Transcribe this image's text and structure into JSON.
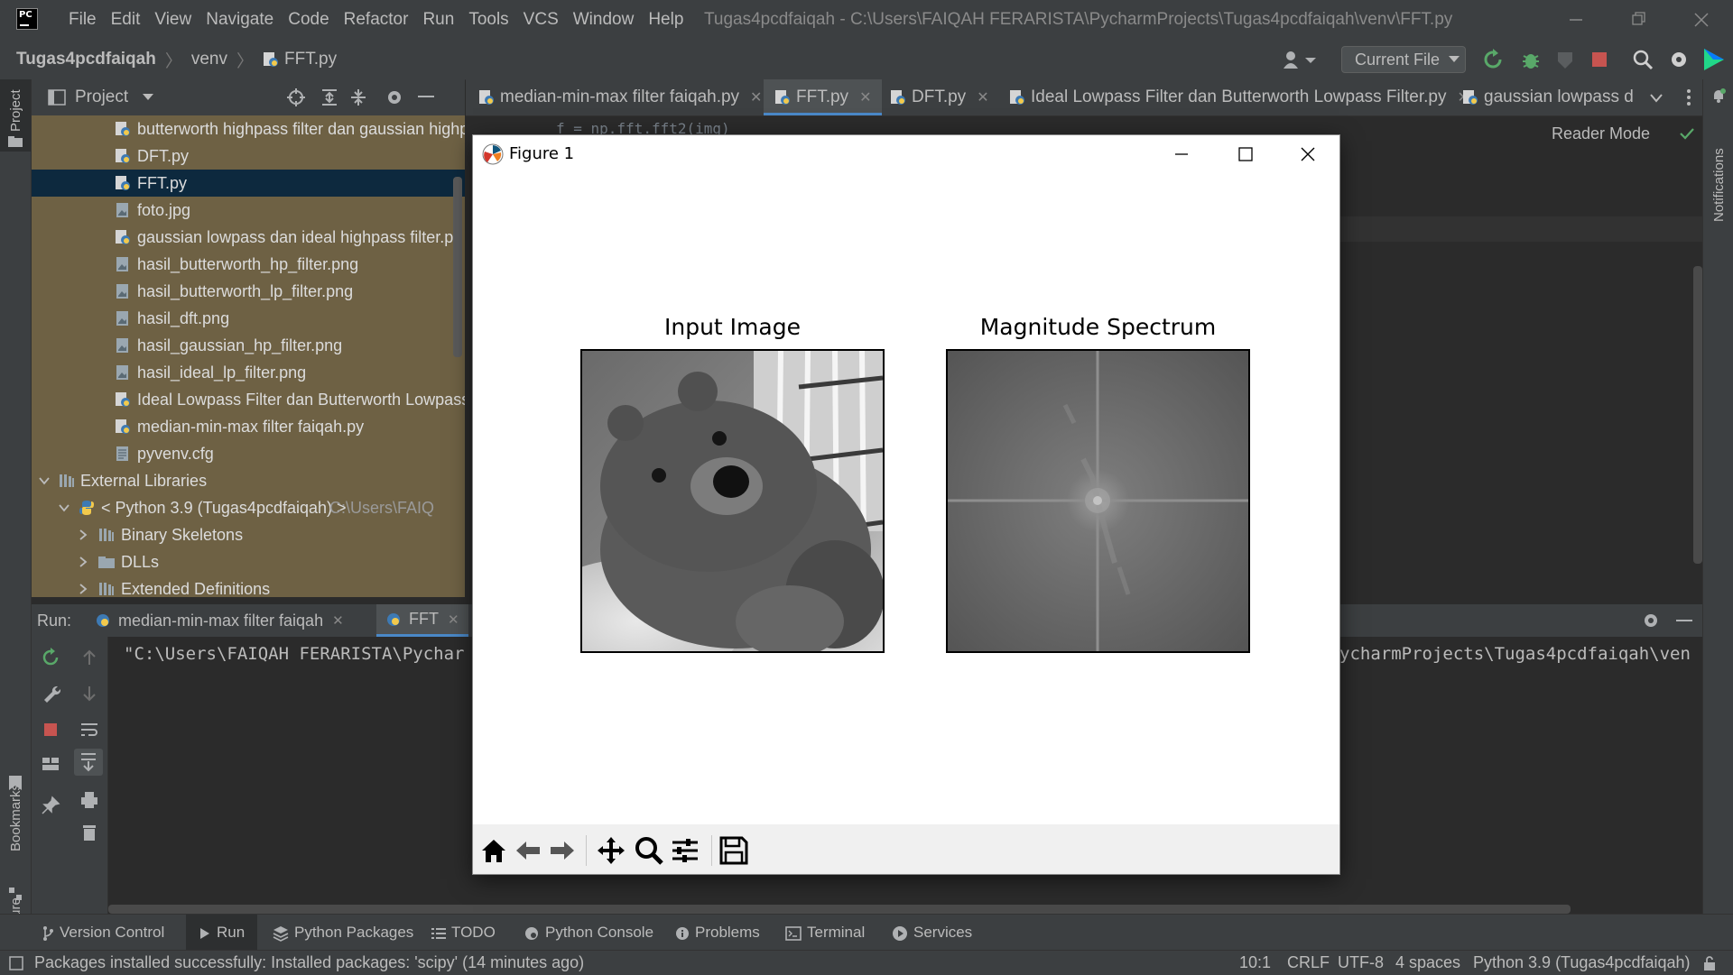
{
  "menubar": {
    "items": [
      "File",
      "Edit",
      "View",
      "Navigate",
      "Code",
      "Refactor",
      "Run",
      "Tools",
      "VCS",
      "Window",
      "Help"
    ],
    "window_title": "Tugas4pcdfaiqah - C:\\Users\\FAIQAH FERARISTA\\PycharmProjects\\Tugas4pcdfaiqah\\venv\\FFT.py"
  },
  "navbar": {
    "crumbs": [
      "Tugas4pcdfaiqah",
      "venv",
      "FFT.py"
    ],
    "run_config": "Current File"
  },
  "left_stripe": {
    "project": "Project",
    "bookmarks": "Bookmarks",
    "structure": "Structure"
  },
  "right_stripe": {
    "notifications": "Notifications"
  },
  "project_panel": {
    "title": "Project",
    "files": [
      "butterworth highpass filter dan gaussian highp",
      "DFT.py",
      "FFT.py",
      "foto.jpg",
      "gaussian lowpass dan ideal highpass filter.py",
      "hasil_butterworth_hp_filter.png",
      "hasil_butterworth_lp_filter.png",
      "hasil_dft.png",
      "hasil_gaussian_hp_filter.png",
      "hasil_ideal_lp_filter.png",
      "Ideal Lowpass Filter dan Butterworth Lowpass",
      "median-min-max filter faiqah.py",
      "pyvenv.cfg"
    ],
    "external_libraries": "External Libraries",
    "python_sdk": "< Python 3.9 (Tugas4pcdfaiqah) >",
    "python_sdk_path": "C:\\Users\\FAIQ",
    "binary_skeletons": "Binary Skeletons",
    "dlls": "DLLs",
    "extended_definitions": "Extended Definitions"
  },
  "editor_tabs": [
    {
      "label": "median-min-max filter faiqah.py",
      "active": false
    },
    {
      "label": "FFT.py",
      "active": true
    },
    {
      "label": "DFT.py",
      "active": false
    },
    {
      "label": "Ideal Lowpass Filter dan Butterworth Lowpass Filter.py",
      "active": false
    },
    {
      "label": "gaussian lowpass d",
      "active": false
    }
  ],
  "editor": {
    "reader_mode": "Reader Mode",
    "code_fragment": "f = np.fft.fft2(img)"
  },
  "run_panel": {
    "label": "Run:",
    "tabs": [
      "median-min-max filter faiqah",
      "FFT"
    ],
    "console_left": "\"C:\\Users\\FAIQAH FERARISTA\\Pychar",
    "console_right": "ycharmProjects\\Tugas4pcdfaiqah\\ven"
  },
  "tool_windows": [
    "Version Control",
    "Run",
    "Python Packages",
    "TODO",
    "Python Console",
    "Problems",
    "Terminal",
    "Services"
  ],
  "status_bar": {
    "message": "Packages installed successfully: Installed packages: 'scipy' (14 minutes ago)",
    "position": "10:1",
    "line_sep": "CRLF",
    "encoding": "UTF-8",
    "indent": "4 spaces",
    "interpreter": "Python 3.9 (Tugas4pcdfaiqah)"
  },
  "figure": {
    "window_title": "Figure 1",
    "subplots": [
      {
        "title": "Input Image"
      },
      {
        "title": "Magnitude Spectrum"
      }
    ]
  },
  "colors": {
    "ide_bg": "#2b2b2b",
    "panel_bg": "#3c3f41",
    "tree_bg": "#6e6144",
    "selection": "#0d293e",
    "accent": "#4a88c7"
  }
}
